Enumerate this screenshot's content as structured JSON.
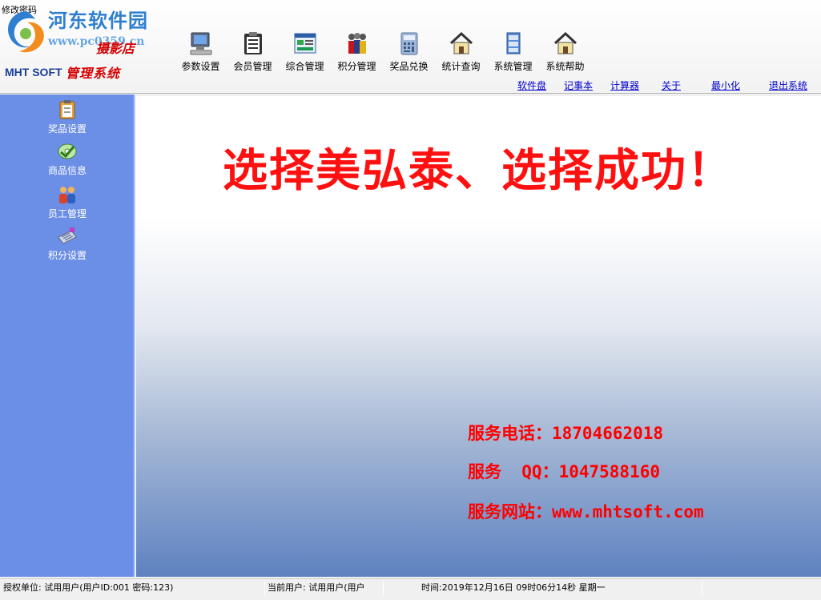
{
  "menu": {
    "edit_password": "修改密码"
  },
  "watermark": {
    "title": "河东软件园",
    "url": "www.pc0359.cn"
  },
  "logo": {
    "company": "MHT SOFT",
    "shop": "摄影店",
    "system": "管理系统"
  },
  "toolbar": {
    "items": [
      {
        "label": "参数设置",
        "icon": "computer-icon"
      },
      {
        "label": "会员管理",
        "icon": "clipboard-icon"
      },
      {
        "label": "综合管理",
        "icon": "window-icon"
      },
      {
        "label": "积分管理",
        "icon": "people-icon"
      },
      {
        "label": "奖品兑换",
        "icon": "calculator-icon"
      },
      {
        "label": "统计查询",
        "icon": "house-icon"
      },
      {
        "label": "系统管理",
        "icon": "cabinet-icon"
      },
      {
        "label": "系统帮助",
        "icon": "house-icon"
      }
    ]
  },
  "links": {
    "software_disk": "软件盘",
    "notepad": "记事本",
    "calculator": "计算器",
    "about": "关于",
    "minimize": "最小化",
    "exit": "退出系统"
  },
  "sidebar": {
    "items": [
      {
        "label": "奖品设置",
        "icon": "clipboard-icon"
      },
      {
        "label": "商品信息",
        "icon": "disc-icon"
      },
      {
        "label": "员工管理",
        "icon": "staff-icon"
      },
      {
        "label": "积分设置",
        "icon": "keyboard-icon"
      }
    ]
  },
  "main": {
    "slogan": "选择美弘泰、选择成功！",
    "phone": "服务电话：18704662018",
    "qq": "服务  QQ：1047588160",
    "website": "服务网站：www.mhtsoft.com"
  },
  "status": {
    "auth_unit": "授权单位: 试用用户(用户ID:001 密码:123)",
    "current_user": "当前用户: 试用用户(用户",
    "time": "时间:2019年12月16日 09时06分14秒 星期一"
  },
  "colors": {
    "sidebar_bg": "#6b8ee6",
    "slogan_red": "#ff1010",
    "link_blue": "#0000cc",
    "brand_blue": "#1c3f99"
  }
}
